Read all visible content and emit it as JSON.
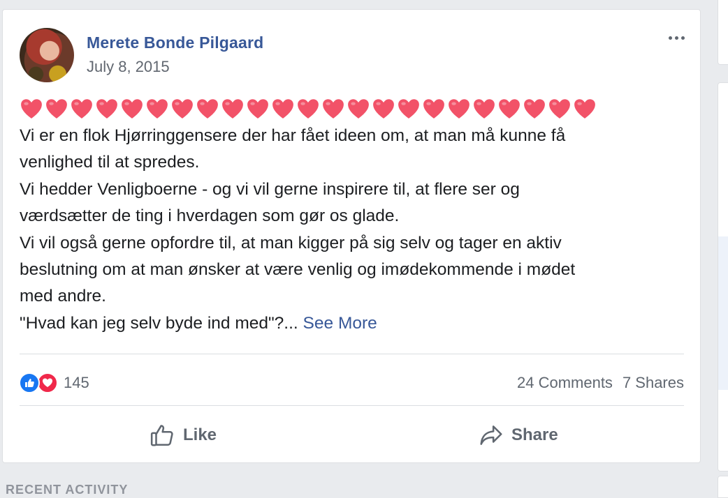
{
  "post": {
    "author": "Merete Bonde Pilgaard",
    "date": "July 8, 2015",
    "hearts_count": 23,
    "lines": [
      "Vi er en flok Hjørringgensere der har fået ideen om, at man må kunne få",
      "venlighed til at spredes.",
      "Vi hedder Venligboerne - og vi vil gerne inspirere til, at flere ser og",
      "værdsætter de ting i hverdagen som gør os glade.",
      "Vi vil også gerne opfordre til, at man kigger på sig selv og tager en aktiv",
      "beslutning om at man ønsker at være venlig og imødekommende i mødet",
      "med andre."
    ],
    "last_line": "\"Hvad kan jeg selv byde ind med\"?...",
    "see_more": "See More"
  },
  "reactions": {
    "count": "145",
    "icons": [
      "like-icon",
      "love-icon"
    ],
    "like_color": "#1877f2",
    "love_color": "#f0284a"
  },
  "stats": {
    "comments": "24 Comments",
    "shares": "7 Shares"
  },
  "actions": {
    "like": "Like",
    "share": "Share"
  },
  "sidebar": {
    "section_title": "RECENT ACTIVITY"
  },
  "colors": {
    "link": "#385898",
    "heart": "#f25268",
    "background": "#e9ebee"
  }
}
